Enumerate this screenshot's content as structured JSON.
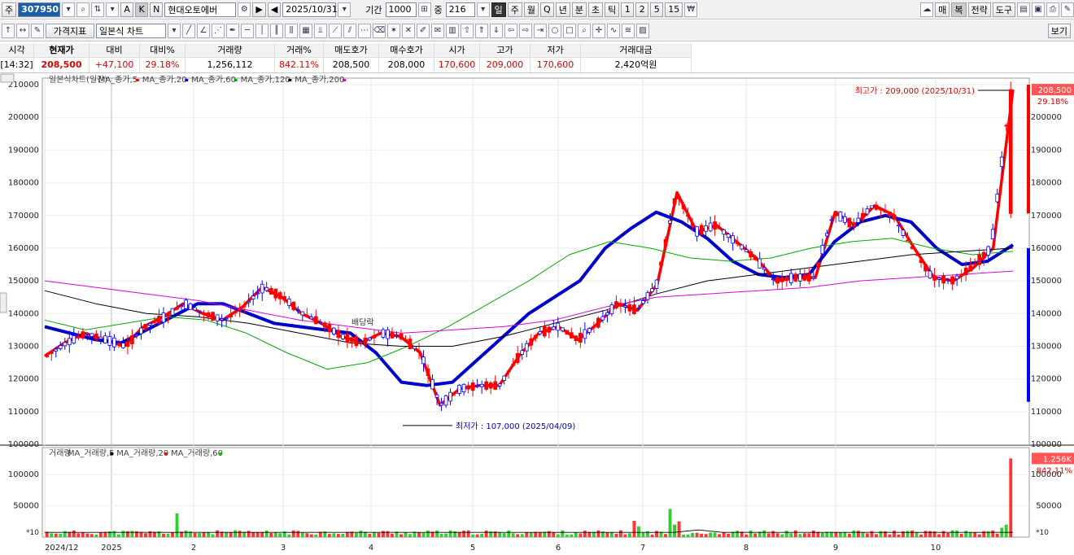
{
  "toolbar": {
    "market_label": "주",
    "code": "307950",
    "stock_name": "현대오토에버",
    "date": "2025/10/31",
    "period_label": "기간",
    "period_value": "1000",
    "count_label": "중",
    "count_value": "216",
    "btn_a": "A",
    "btn_k": "K",
    "btn_n": "N",
    "tf_tabs": [
      "일",
      "주",
      "월",
      "Q",
      "년",
      "분",
      "초",
      "틱",
      "1",
      "2",
      "5",
      "15"
    ],
    "right_buttons": [
      "매",
      "복",
      "전략",
      "도구"
    ],
    "price_index_label": "가격지표",
    "chart_type": "일본식 차트",
    "view_label": "보기"
  },
  "info_table": {
    "headers": [
      "시각",
      "현재가",
      "대비",
      "대비%",
      "거래량",
      "거래%",
      "매도호가",
      "매수호가",
      "시가",
      "고가",
      "저가",
      "거래대금"
    ],
    "values": [
      "[14:32]",
      "208,500",
      "+47,100",
      "29.18%",
      "1,256,112",
      "842.11%",
      "208,500",
      "208,000",
      "170,600",
      "209,000",
      "170,600",
      "2,420억원"
    ]
  },
  "price_chart": {
    "legend": [
      {
        "text": "일본식차트(일간)",
        "color": "#333333"
      },
      {
        "text": "MA_종가,5",
        "color": "#ff0000"
      },
      {
        "text": "MA_종가,20",
        "color": "#0000cc"
      },
      {
        "text": "MA_종가,60",
        "color": "#00aa00"
      },
      {
        "text": "MA_종가,120",
        "color": "#000000"
      },
      {
        "text": "MA_종가,200",
        "color": "#dd00dd"
      }
    ],
    "y_ticks": [
      "210000",
      "200000",
      "190000",
      "180000",
      "170000",
      "160000",
      "150000",
      "140000",
      "130000",
      "120000",
      "110000",
      "100000"
    ],
    "high_annotation": "최고가 : 209,000 (2025/10/31)",
    "low_annotation": "최저가 : 107,000 (2025/04/09)",
    "dividend_label": "배당락",
    "current_price_tag": "208,500",
    "current_pct_tag": "29.18%"
  },
  "volume_chart": {
    "legend": [
      {
        "text": "거래량",
        "color": "#333333"
      },
      {
        "text": "MA_거래량,5",
        "color": "#000000"
      },
      {
        "text": "MA_거래량,20",
        "color": "#ff0000"
      },
      {
        "text": "MA_거래량,60",
        "color": "#00cc00"
      }
    ],
    "y_ticks": [
      "100000",
      "50000"
    ],
    "unit_label": "*10",
    "current_volume_tag": "1,256K",
    "current_pct_tag": "842.11%"
  },
  "x_axis": [
    "2024/12",
    "2025",
    "2",
    "3",
    "4",
    "5",
    "6",
    "7",
    "8",
    "9",
    "10"
  ],
  "colors": {
    "up": "#ff0000",
    "down": "#0000ff",
    "ma20": "#0000cc",
    "ma60": "#00aa00",
    "ma120": "#000000",
    "ma200": "#dd00dd",
    "vol_up": "#33cc33",
    "vol_down": "#ff3333"
  },
  "chart_data": {
    "type": "line",
    "title": "일본식차트(일간)",
    "ylim": [
      100000,
      212000
    ],
    "series": [
      {
        "name": "MA_종가,5",
        "values": [
          127000,
          131000,
          134000,
          132000,
          130000,
          136000,
          139000,
          143000,
          140000,
          138000,
          142000,
          148000,
          145000,
          140000,
          137000,
          133000,
          131000,
          134000,
          133000,
          128000,
          112000,
          117000,
          118000,
          118000,
          127000,
          134000,
          136000,
          132000,
          137000,
          143000,
          141000,
          149000,
          177000,
          165000,
          167000,
          162000,
          157000,
          150000,
          151000,
          151000,
          171000,
          167000,
          173000,
          170000,
          160000,
          151000,
          150000,
          154000,
          160000,
          208500
        ]
      },
      {
        "name": "MA_종가,20",
        "values": [
          136000,
          134000,
          132000,
          131000,
          135000,
          139000,
          143000,
          143000,
          140000,
          137000,
          136000,
          135000,
          134000,
          128000,
          119000,
          118000,
          119000,
          126000,
          133000,
          140000,
          145000,
          150000,
          160000,
          166000,
          171000,
          168000,
          163000,
          156000,
          152000,
          151000,
          152000,
          162000,
          168000,
          170000,
          168000,
          160000,
          155000,
          156000,
          161000
        ]
      },
      {
        "name": "MA_종가,60",
        "values": [
          138000,
          135000,
          137000,
          139000,
          138000,
          134000,
          128000,
          123000,
          125000,
          130000,
          136000,
          143000,
          150000,
          158000,
          162000,
          160000,
          157000,
          156000,
          157000,
          160000,
          162000,
          163000,
          160000,
          158000,
          159000
        ]
      },
      {
        "name": "MA_종가,120",
        "values": [
          147000,
          143000,
          140000,
          139000,
          137000,
          134000,
          131000,
          130000,
          130000,
          133000,
          137000,
          141000,
          146000,
          150000,
          152000,
          154000,
          156000,
          158000,
          159000,
          160000
        ]
      },
      {
        "name": "MA_종가,200",
        "values": [
          150000,
          148000,
          146000,
          144000,
          141000,
          138000,
          136000,
          134000,
          135000,
          136000,
          138000,
          142000,
          145000,
          146000,
          147000,
          148000,
          150000,
          151000,
          152000,
          153000
        ]
      }
    ]
  }
}
